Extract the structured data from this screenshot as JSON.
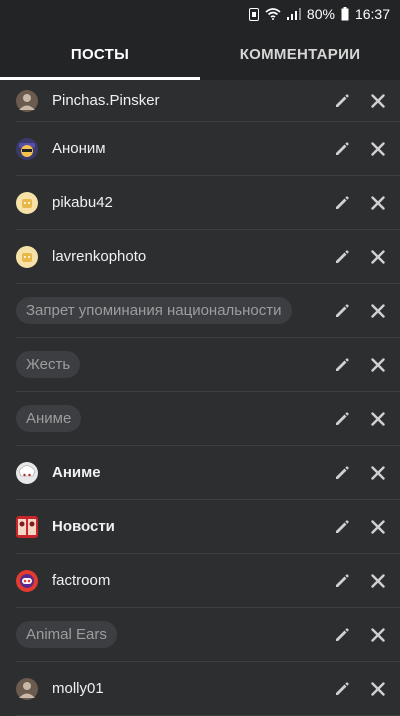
{
  "status": {
    "battery": "80%",
    "time": "16:37"
  },
  "tabs": [
    {
      "label": "ПОСТЫ",
      "active": true
    },
    {
      "label": "КОММЕНТАРИИ",
      "active": false
    }
  ],
  "items": [
    {
      "type": "user",
      "label": "Pinchas.Pinsker",
      "avatar": "user-avatar-icon",
      "bold": false
    },
    {
      "type": "user",
      "label": "Аноним",
      "avatar": "anon-avatar-icon",
      "bold": false
    },
    {
      "type": "user",
      "label": "pikabu42",
      "avatar": "default-avatar-icon",
      "bold": false
    },
    {
      "type": "user",
      "label": "lavrenkophoto",
      "avatar": "default-avatar-icon",
      "bold": false
    },
    {
      "type": "tag",
      "label": "Запрет упоминания национальности"
    },
    {
      "type": "tag",
      "label": "Жесть"
    },
    {
      "type": "tag",
      "label": "Аниме"
    },
    {
      "type": "community",
      "label": "Аниме",
      "avatar": "anime-avatar-icon",
      "bold": true
    },
    {
      "type": "community",
      "label": "Новости",
      "avatar": "news-avatar-icon",
      "bold": true
    },
    {
      "type": "user",
      "label": "factroom",
      "avatar": "factroom-avatar-icon",
      "bold": false
    },
    {
      "type": "tag",
      "label": "Animal Ears"
    },
    {
      "type": "user",
      "label": "molly01",
      "avatar": "user-avatar-icon",
      "bold": false
    }
  ],
  "colors": {
    "background": "#2d2e30",
    "header": "#232426",
    "divider": "#3e3f42",
    "tag_bg": "#3d3e41",
    "tag_text": "#9c9d9f"
  }
}
